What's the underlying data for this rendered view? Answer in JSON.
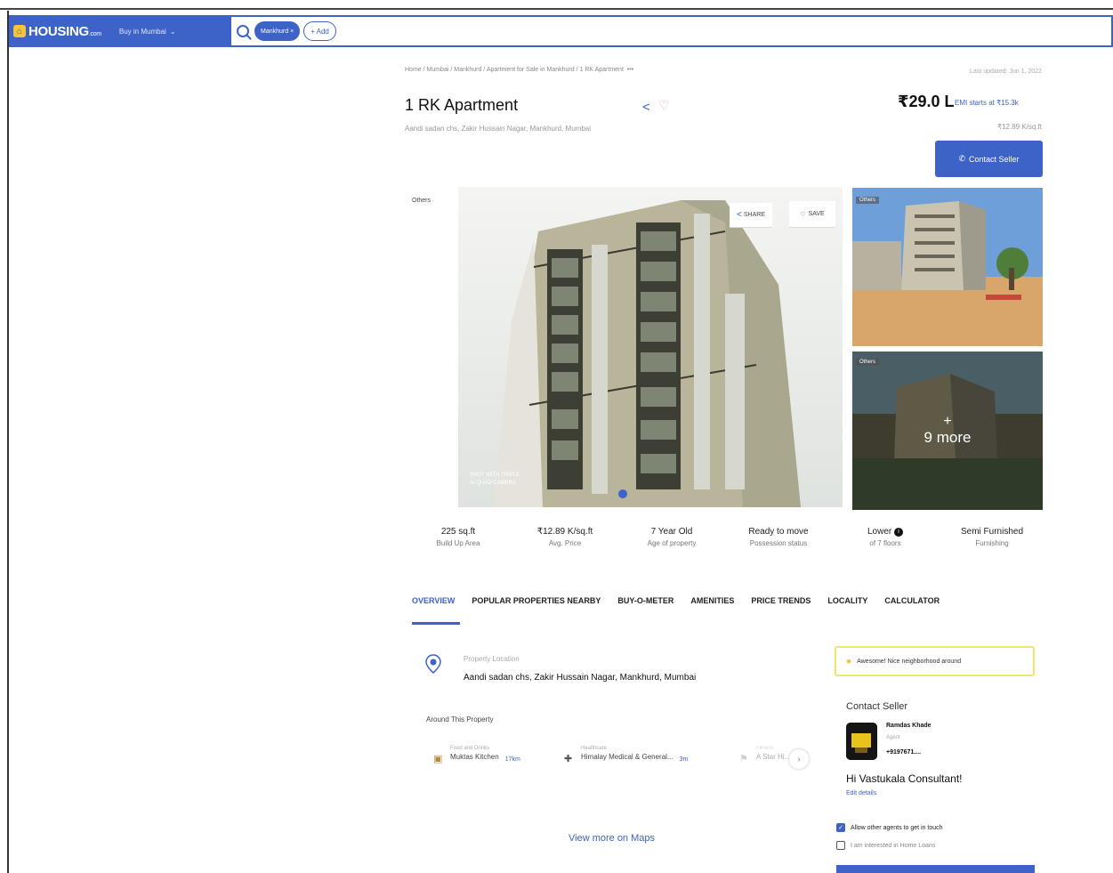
{
  "header": {
    "logo_text": "HOUSING",
    "logo_suffix": ".com",
    "city": "Buy in Mumbai",
    "search_chip": "Mankhurd",
    "add_label": "+ Add"
  },
  "breadcrumb": "Home / Mumbai / Mankhurd / Apartment for Sale in Mankhurd / 1 RK Apartment",
  "last_updated": "Last updated: Jun 1, 2022",
  "listing": {
    "title": "1 RK Apartment",
    "address": "Aandi sadan chs, Zakir Hussain Nagar, Mankhurd, Mumbai",
    "price": "₹29.0 L",
    "emi": "EMI starts at ₹15.3k",
    "price_per_sqft": "₹12.89 K/sq.ft",
    "contact_button": "Contact Seller"
  },
  "gallery": {
    "others_tag": "Others",
    "share_label": "SHARE",
    "save_label": "SAVE",
    "cam_caption_1": "SHOT WITH TRIPLE",
    "cam_caption_2": "AI QUAD CAMERA",
    "thumb_tag_1": "Others",
    "thumb_tag_2": "Others",
    "more_plus": "+",
    "more_label": "9 more"
  },
  "facts": [
    {
      "value": "225 sq.ft",
      "label": "Build Up Area"
    },
    {
      "value": "₹12.89 K/sq.ft",
      "label": "Avg. Price"
    },
    {
      "value": "7 Year Old",
      "label": "Age of property"
    },
    {
      "value": "Ready to move",
      "label": "Possession status"
    },
    {
      "value": "Lower",
      "label": "of 7 floors"
    },
    {
      "value": "Semi Furnished",
      "label": "Furnishing"
    }
  ],
  "tabs": [
    "OVERVIEW",
    "POPULAR PROPERTIES NEARBY",
    "BUY-O-METER",
    "AMENITIES",
    "PRICE TRENDS",
    "LOCALITY",
    "CALCULATOR"
  ],
  "overview": {
    "location_label": "Property Location",
    "location_value": "Aandi sadan chs, Zakir Hussain Nagar, Mankhurd, Mumbai",
    "around_heading": "Around This Property",
    "amenities": [
      {
        "category": "Food and Drinks",
        "name": "Muktas Kitchen",
        "distance": "17km"
      },
      {
        "category": "Healthcare",
        "name": "Himalay Medical & General...",
        "distance": "3m"
      },
      {
        "category": "Fitness",
        "name": "A Star Hi...",
        "distance": ""
      }
    ],
    "view_maps": "View more on Maps"
  },
  "sidebar": {
    "awesome_text": "Awesome! Nice neighborhood around",
    "contact_heading": "Contact Seller",
    "agent_name": "Ramdas Khade",
    "agent_role": "Agent",
    "agent_phone": "+9197671....",
    "hi_message": "Hi Vastukala Consultant!",
    "edit_details": "Edit details",
    "checkbox_1": "Allow other agents to get in touch",
    "checkbox_2": "I am interested in Home Loans"
  },
  "colors": {
    "brand_blue": "#3d63c8",
    "highlight_yellow": "#f6e36b"
  }
}
